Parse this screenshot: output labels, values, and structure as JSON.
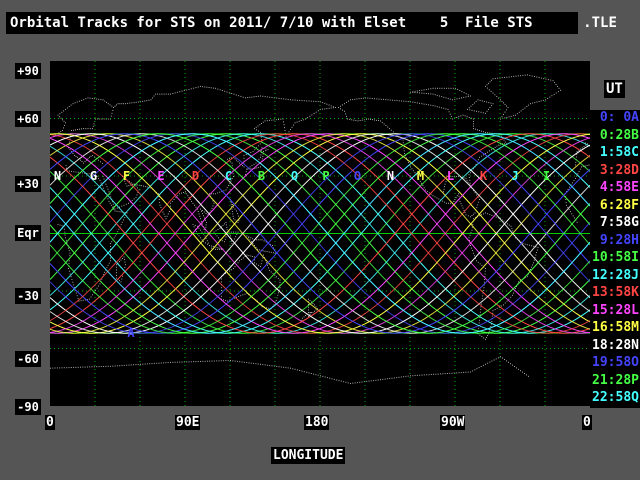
{
  "title": "Orbital Tracks for STS on 2011/ 7/10 with Elset    5  File STS      .TLE",
  "latitude_labels": [
    "+90",
    "+60",
    "+30",
    "Eqr",
    "-30",
    "-60",
    "-90"
  ],
  "longitude_labels": [
    "0",
    "90E",
    "180",
    "90W",
    "0"
  ],
  "x_axis_title": "LONGITUDE",
  "legend_title": "UT",
  "legend": [
    {
      "label": "0: 0A",
      "color": "#4444ff"
    },
    {
      "label": "0:28B",
      "color": "#44ff44"
    },
    {
      "label": "1:58C",
      "color": "#44ffff"
    },
    {
      "label": "3:28D",
      "color": "#ff4444"
    },
    {
      "label": "4:58E",
      "color": "#ff44ff"
    },
    {
      "label": "6:28F",
      "color": "#ffff44"
    },
    {
      "label": "7:58G",
      "color": "#ffffff"
    },
    {
      "label": "9:28H",
      "color": "#4444ff"
    },
    {
      "label": "10:58I",
      "color": "#44ff44"
    },
    {
      "label": "12:28J",
      "color": "#44ffff"
    },
    {
      "label": "13:58K",
      "color": "#ff4444"
    },
    {
      "label": "15:28L",
      "color": "#ff44ff"
    },
    {
      "label": "16:58M",
      "color": "#ffff44"
    },
    {
      "label": "18:28N",
      "color": "#ffffff"
    },
    {
      "label": "19:58O",
      "color": "#4444ff"
    },
    {
      "label": "21:28P",
      "color": "#44ff44"
    },
    {
      "label": "22:58Q",
      "color": "#44ffff"
    }
  ],
  "track_markers": [
    {
      "letter": "N",
      "color": "#ffffff",
      "lon": 5
    },
    {
      "letter": "G",
      "color": "#ffffff",
      "lon": 29
    },
    {
      "letter": "F",
      "color": "#ffff44",
      "lon": 51
    },
    {
      "letter": "E",
      "color": "#ff44ff",
      "lon": 74
    },
    {
      "letter": "D",
      "color": "#ff4444",
      "lon": 97
    },
    {
      "letter": "C",
      "color": "#44ffff",
      "lon": 119
    },
    {
      "letter": "B",
      "color": "#44ff44",
      "lon": 141
    },
    {
      "letter": "Q",
      "color": "#44ffff",
      "lon": 163
    },
    {
      "letter": "P",
      "color": "#44ff44",
      "lon": 184
    },
    {
      "letter": "O",
      "color": "#4444ff",
      "lon": 205
    },
    {
      "letter": "N",
      "color": "#ffffff",
      "lon": 227
    },
    {
      "letter": "M",
      "color": "#ffff44",
      "lon": 247
    },
    {
      "letter": "L",
      "color": "#ff44ff",
      "lon": 267
    },
    {
      "letter": "K",
      "color": "#ff4444",
      "lon": 289
    },
    {
      "letter": "J",
      "color": "#44ffff",
      "lon": 310
    },
    {
      "letter": "I",
      "color": "#44ff44",
      "lon": 331
    },
    {
      "letter": "A",
      "color": "#4444ff",
      "lon": 54,
      "lat": -52
    }
  ],
  "orbit": {
    "inclination_deg": 52,
    "tracks": 17,
    "track_spacing_deg": 22.5
  },
  "colors": {
    "background": "#555555",
    "map": "#000000",
    "grid": "#00aa00",
    "equator": "#00cc00",
    "coast": "#aaaaaa"
  }
}
